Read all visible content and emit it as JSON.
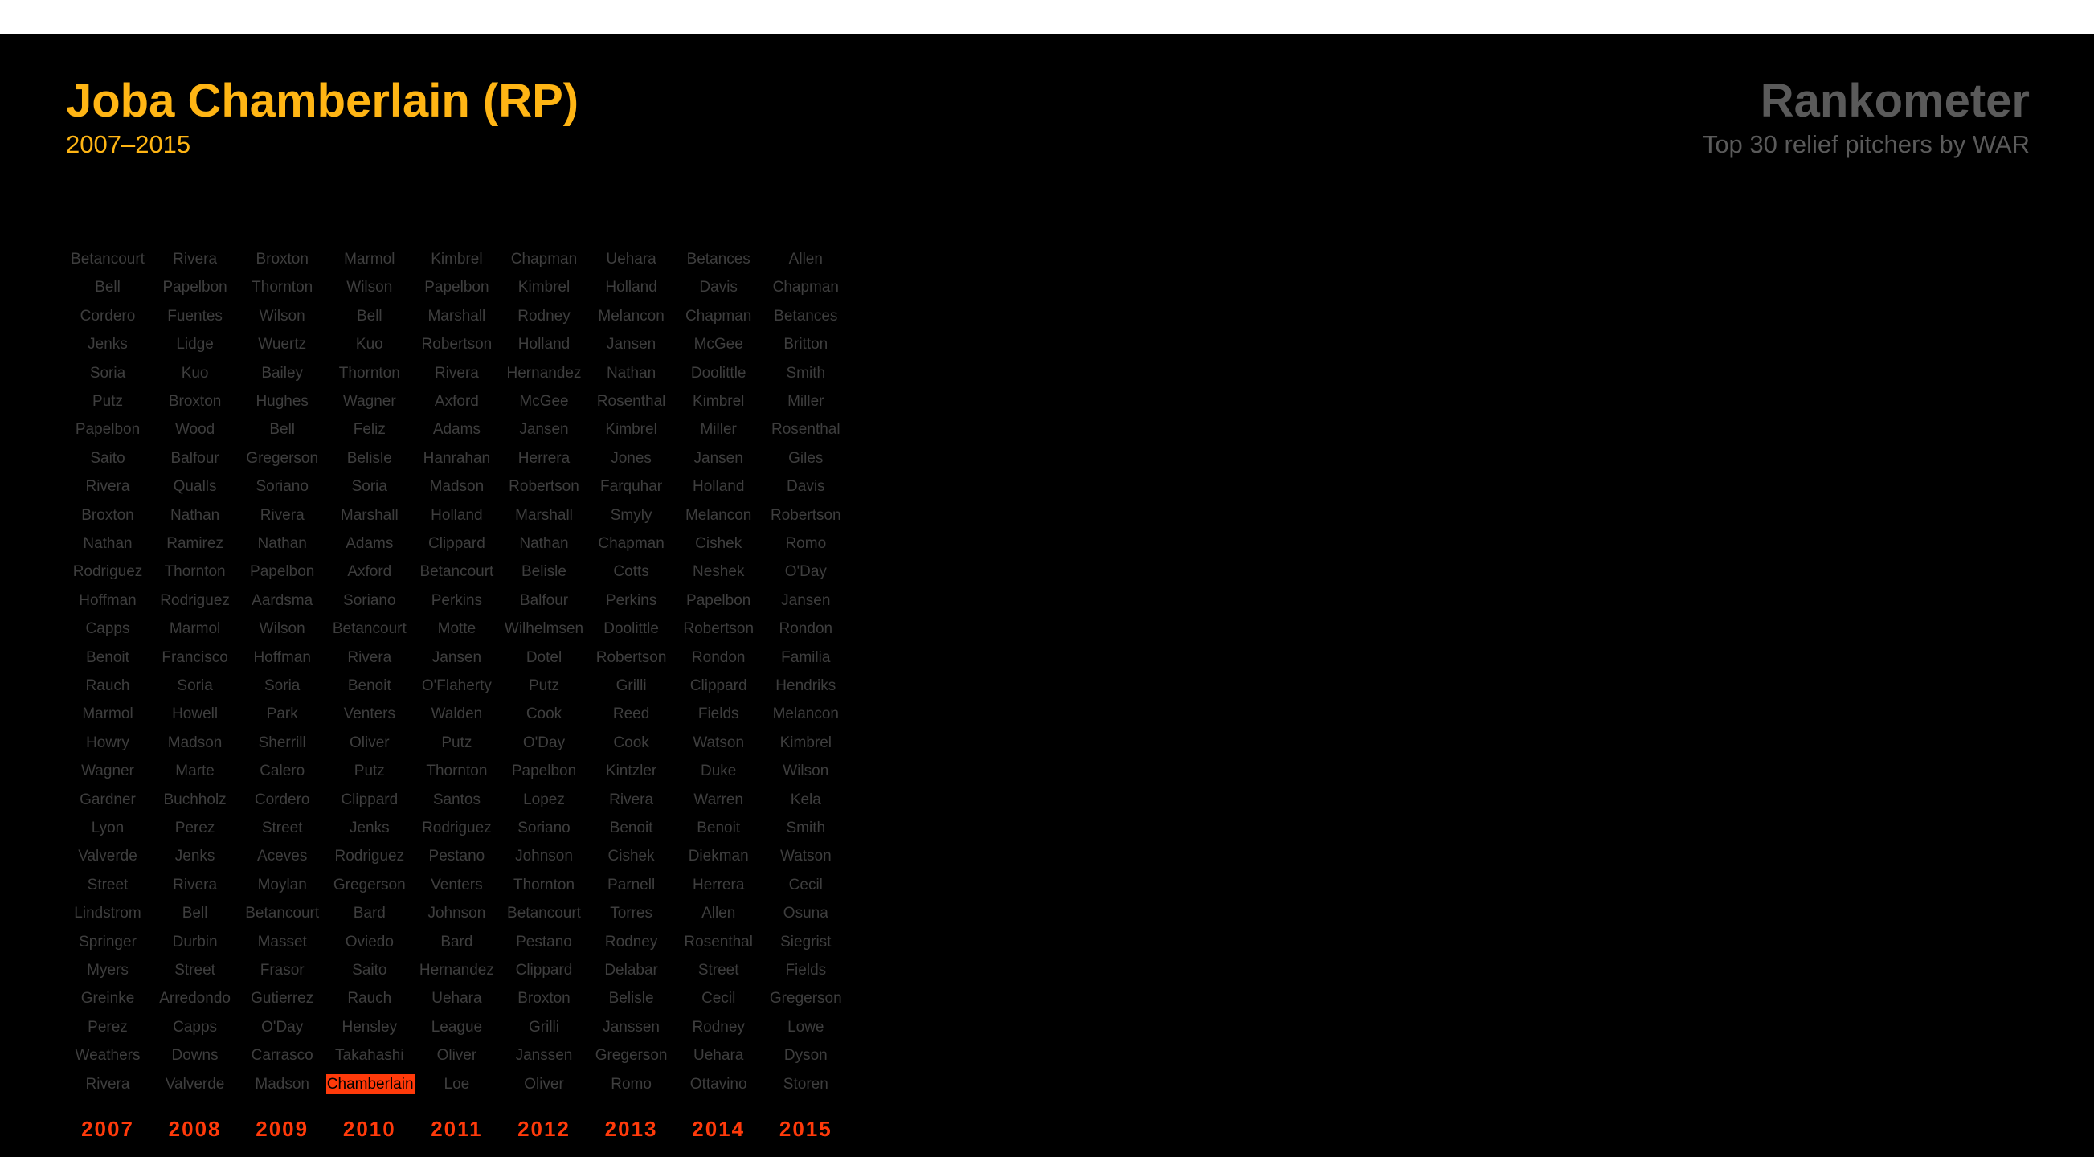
{
  "header": {
    "player_title": "Joba Chamberlain (RP)",
    "player_years": "2007–2015",
    "brand_title": "Rankometer",
    "brand_subtitle": "Top 30 relief pitchers by WAR"
  },
  "colors": {
    "accent_yellow": "#ffb514",
    "accent_red": "#ff3a0a",
    "muted_text": "#3e3e3e",
    "brand_gray": "#5a5a5a",
    "background": "#000000"
  },
  "highlight_player": "Chamberlain",
  "columns": [
    {
      "year": "2007",
      "names": [
        "Betancourt",
        "Bell",
        "Cordero",
        "Jenks",
        "Soria",
        "Putz",
        "Papelbon",
        "Saito",
        "Rivera",
        "Broxton",
        "Nathan",
        "Rodriguez",
        "Hoffman",
        "Capps",
        "Benoit",
        "Rauch",
        "Marmol",
        "Howry",
        "Wagner",
        "Gardner",
        "Lyon",
        "Valverde",
        "Street",
        "Lindstrom",
        "Springer",
        "Myers",
        "Greinke",
        "Perez",
        "Weathers",
        "Rivera"
      ]
    },
    {
      "year": "2008",
      "names": [
        "Rivera",
        "Papelbon",
        "Fuentes",
        "Lidge",
        "Kuo",
        "Broxton",
        "Wood",
        "Balfour",
        "Qualls",
        "Nathan",
        "Ramirez",
        "Thornton",
        "Rodriguez",
        "Marmol",
        "Francisco",
        "Soria",
        "Howell",
        "Madson",
        "Marte",
        "Buchholz",
        "Perez",
        "Jenks",
        "Rivera",
        "Bell",
        "Durbin",
        "Street",
        "Arredondo",
        "Capps",
        "Downs",
        "Valverde"
      ]
    },
    {
      "year": "2009",
      "names": [
        "Broxton",
        "Thornton",
        "Wilson",
        "Wuertz",
        "Bailey",
        "Hughes",
        "Bell",
        "Gregerson",
        "Soriano",
        "Rivera",
        "Nathan",
        "Papelbon",
        "Aardsma",
        "Wilson",
        "Hoffman",
        "Soria",
        "Park",
        "Sherrill",
        "Calero",
        "Cordero",
        "Street",
        "Aceves",
        "Moylan",
        "Betancourt",
        "Masset",
        "Frasor",
        "Gutierrez",
        "O'Day",
        "Carrasco",
        "Madson"
      ]
    },
    {
      "year": "2010",
      "names": [
        "Marmol",
        "Wilson",
        "Bell",
        "Kuo",
        "Thornton",
        "Wagner",
        "Feliz",
        "Belisle",
        "Soria",
        "Marshall",
        "Adams",
        "Axford",
        "Soriano",
        "Betancourt",
        "Rivera",
        "Benoit",
        "Venters",
        "Oliver",
        "Putz",
        "Clippard",
        "Jenks",
        "Rodriguez",
        "Gregerson",
        "Bard",
        "Oviedo",
        "Saito",
        "Rauch",
        "Hensley",
        "Takahashi",
        "Chamberlain"
      ]
    },
    {
      "year": "2011",
      "names": [
        "Kimbrel",
        "Papelbon",
        "Marshall",
        "Robertson",
        "Rivera",
        "Axford",
        "Adams",
        "Hanrahan",
        "Madson",
        "Holland",
        "Clippard",
        "Betancourt",
        "Perkins",
        "Motte",
        "Jansen",
        "O'Flaherty",
        "Walden",
        "Putz",
        "Thornton",
        "Santos",
        "Rodriguez",
        "Pestano",
        "Venters",
        "Johnson",
        "Bard",
        "Hernandez",
        "Uehara",
        "League",
        "Oliver",
        "Loe"
      ]
    },
    {
      "year": "2012",
      "names": [
        "Chapman",
        "Kimbrel",
        "Rodney",
        "Holland",
        "Hernandez",
        "McGee",
        "Jansen",
        "Herrera",
        "Robertson",
        "Marshall",
        "Nathan",
        "Belisle",
        "Balfour",
        "Wilhelmsen",
        "Dotel",
        "Putz",
        "Cook",
        "O'Day",
        "Papelbon",
        "Lopez",
        "Soriano",
        "Johnson",
        "Thornton",
        "Betancourt",
        "Pestano",
        "Clippard",
        "Broxton",
        "Grilli",
        "Janssen",
        "Oliver"
      ]
    },
    {
      "year": "2013",
      "names": [
        "Uehara",
        "Holland",
        "Melancon",
        "Jansen",
        "Nathan",
        "Rosenthal",
        "Kimbrel",
        "Jones",
        "Farquhar",
        "Smyly",
        "Chapman",
        "Cotts",
        "Perkins",
        "Doolittle",
        "Robertson",
        "Grilli",
        "Reed",
        "Cook",
        "Kintzler",
        "Rivera",
        "Benoit",
        "Cishek",
        "Parnell",
        "Torres",
        "Rodney",
        "Delabar",
        "Belisle",
        "Janssen",
        "Gregerson",
        "Romo"
      ]
    },
    {
      "year": "2014",
      "names": [
        "Betances",
        "Davis",
        "Chapman",
        "McGee",
        "Doolittle",
        "Kimbrel",
        "Miller",
        "Jansen",
        "Holland",
        "Melancon",
        "Cishek",
        "Neshek",
        "Papelbon",
        "Robertson",
        "Rondon",
        "Clippard",
        "Fields",
        "Watson",
        "Duke",
        "Warren",
        "Benoit",
        "Diekman",
        "Herrera",
        "Allen",
        "Rosenthal",
        "Street",
        "Cecil",
        "Rodney",
        "Uehara",
        "Ottavino"
      ]
    },
    {
      "year": "2015",
      "names": [
        "Allen",
        "Chapman",
        "Betances",
        "Britton",
        "Smith",
        "Miller",
        "Rosenthal",
        "Giles",
        "Davis",
        "Robertson",
        "Romo",
        "O'Day",
        "Jansen",
        "Rondon",
        "Familia",
        "Hendriks",
        "Melancon",
        "Kimbrel",
        "Wilson",
        "Kela",
        "Smith",
        "Watson",
        "Cecil",
        "Osuna",
        "Siegrist",
        "Fields",
        "Gregerson",
        "Lowe",
        "Dyson",
        "Storen"
      ]
    }
  ]
}
